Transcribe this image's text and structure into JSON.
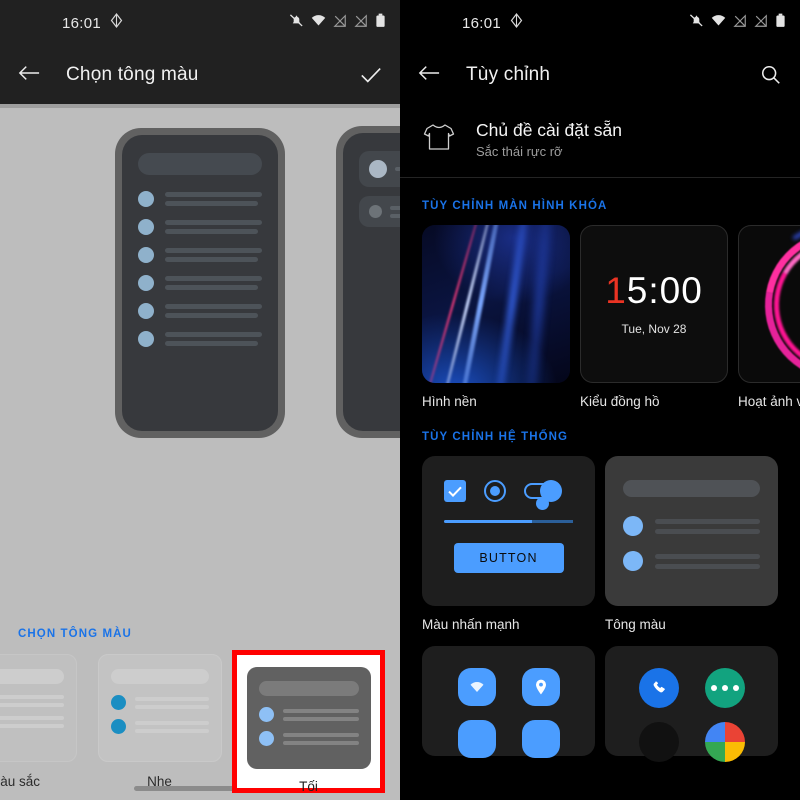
{
  "status_bar": {
    "time": "16:01",
    "icons": [
      "diamond-icon",
      "bell-off-icon",
      "wifi-icon",
      "signal-off-1-icon",
      "signal-off-2-icon",
      "battery-icon"
    ]
  },
  "left_panel": {
    "app_bar": {
      "back_label": "back-arrow",
      "title": "Chọn tông màu",
      "confirm_label": "check"
    },
    "tone_section": {
      "heading": "CHỌN TÔNG MÀU",
      "options": [
        {
          "label": "màu sắc",
          "selected": false
        },
        {
          "label": "Nhẹ",
          "selected": false
        },
        {
          "label": "Tối",
          "selected": true
        }
      ]
    }
  },
  "right_panel": {
    "app_bar": {
      "back_label": "back-arrow",
      "title": "Tùy chỉnh",
      "search_label": "search"
    },
    "theme_row": {
      "title": "Chủ đề cài đặt sẵn",
      "subtitle": "Sắc thái rực rỡ"
    },
    "lockscreen_section": {
      "heading": "TÙY CHỈNH MÀN HÌNH KHÓA",
      "cards": [
        {
          "caption": "Hình nền"
        },
        {
          "caption": "Kiểu đồng hồ",
          "clock_highlight": "1",
          "clock_rest": "5:00",
          "date": "Tue, Nov 28"
        },
        {
          "caption": "Hoạt ảnh vân t"
        }
      ]
    },
    "system_section": {
      "heading": "TÙY CHỈNH HỆ THỐNG",
      "cards": [
        {
          "caption": "Màu nhấn mạnh",
          "button_label": "BUTTON"
        },
        {
          "caption": "Tông màu"
        }
      ]
    }
  },
  "colors": {
    "accent_blue": "#1a73e8",
    "control_blue": "#4b9dff",
    "selection_red": "#ff0000",
    "clock_red": "#ea3323",
    "messages_green": "#12a37f"
  }
}
